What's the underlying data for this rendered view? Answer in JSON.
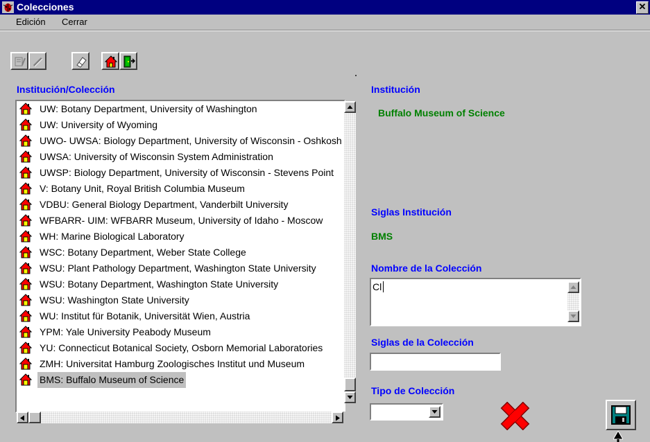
{
  "window": {
    "title": "Colecciones",
    "close_glyph": "✕"
  },
  "menu": [
    {
      "label": "Edición"
    },
    {
      "label": "Cerrar"
    }
  ],
  "toolbar": [
    {
      "icon": "edit-record-icon",
      "enabled": false
    },
    {
      "icon": "pencil-icon",
      "enabled": false
    },
    {
      "icon": "eraser-icon",
      "enabled": true
    },
    {
      "icon": "institution-house-icon",
      "enabled": true
    },
    {
      "icon": "exit-door-icon",
      "enabled": true
    }
  ],
  "list": {
    "heading": "Institución/Colección",
    "items": [
      "UW:  Botany Department, University of Washington",
      "UW:  University of Wyoming",
      "UWO- UWSA:  Biology Department, University of Wisconsin - Oshkosh",
      "UWSA:  University of Wisconsin System Administration",
      "UWSP:  Biology Department, University of Wisconsin - Stevens Point",
      "V:  Botany Unit, Royal British Columbia Museum",
      "VDBU:  General Biology Department, Vanderbilt University",
      "WFBARR- UIM:  WFBARR Museum, University of Idaho - Moscow",
      "WH:  Marine Biological Laboratory",
      "WSC:  Botany Department, Weber State College",
      "WSU:  Plant Pathology Department, Washington State University",
      "WSU:  Botany Department, Washington State University",
      "WSU:  Washington State University",
      "WU:  Institut für Botanik, Universität Wien, Austria",
      "YPM:  Yale University Peabody Museum",
      "YU:  Connecticut Botanical Society, Osborn Memorial Laboratories",
      "ZMH:  Universitat Hamburg Zoologisches Institut und Museum",
      "BMS:  Buffalo Museum of Science"
    ],
    "selected_index": 17
  },
  "detail": {
    "institucion_label": "Institución",
    "institucion_value": "Buffalo Museum of Science",
    "siglas_inst_label": "Siglas Institución",
    "siglas_inst_value": "BMS",
    "nombre_col_label": "Nombre de la Colección",
    "nombre_col_value": "Cl",
    "siglas_col_label": "Siglas de la Colección",
    "siglas_col_value": "",
    "tipo_col_label": "Tipo de Colección",
    "tipo_col_value": ""
  },
  "colors": {
    "title_bar": "#000080",
    "label_blue": "#0000ff",
    "value_green": "#008000",
    "cancel_red": "#ff0000"
  }
}
